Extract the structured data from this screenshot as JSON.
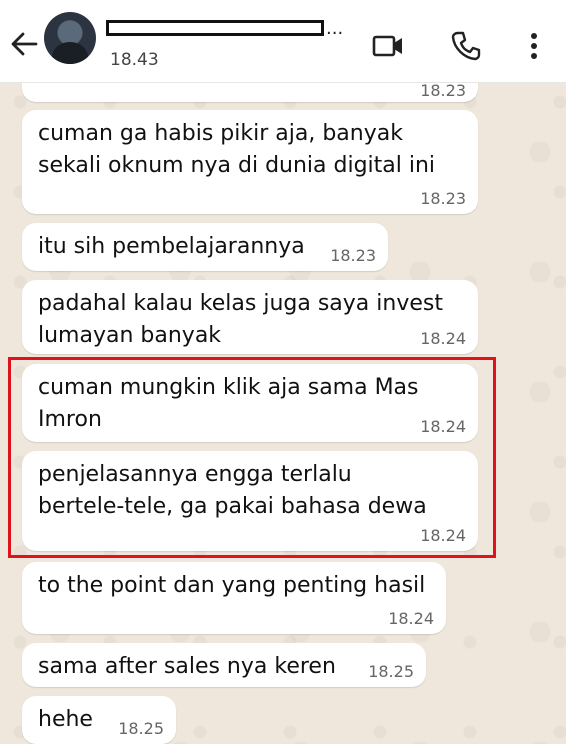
{
  "header": {
    "last_seen": "18.43",
    "name_suffix": "..."
  },
  "icons": {
    "back": "arrow-left-icon",
    "video": "video-call-icon",
    "call": "phone-icon",
    "menu": "more-vertical-icon"
  },
  "messages": [
    {
      "text": "",
      "time": "18.23"
    },
    {
      "text": "cuman ga habis pikir aja, banyak\nsekali oknum nya di dunia digital ini",
      "time": "18.23"
    },
    {
      "text": "itu sih pembelajarannya",
      "time": "18.23"
    },
    {
      "text": "padahal kalau kelas juga saya invest\nlumayan banyak",
      "time": "18.24"
    },
    {
      "text": "cuman mungkin klik aja sama Mas\nImron",
      "time": "18.24"
    },
    {
      "text": "penjelasannya engga terlalu\nbertele-tele, ga pakai bahasa dewa",
      "time": "18.24"
    },
    {
      "text": "to the point dan yang penting hasil",
      "time": "18.24"
    },
    {
      "text": "sama after sales nya keren",
      "time": "18.25"
    },
    {
      "text": "hehe",
      "time": "18.25"
    }
  ],
  "colors": {
    "highlight": "#e0121c",
    "bubble": "#ffffff",
    "background": "#efe7dc"
  }
}
